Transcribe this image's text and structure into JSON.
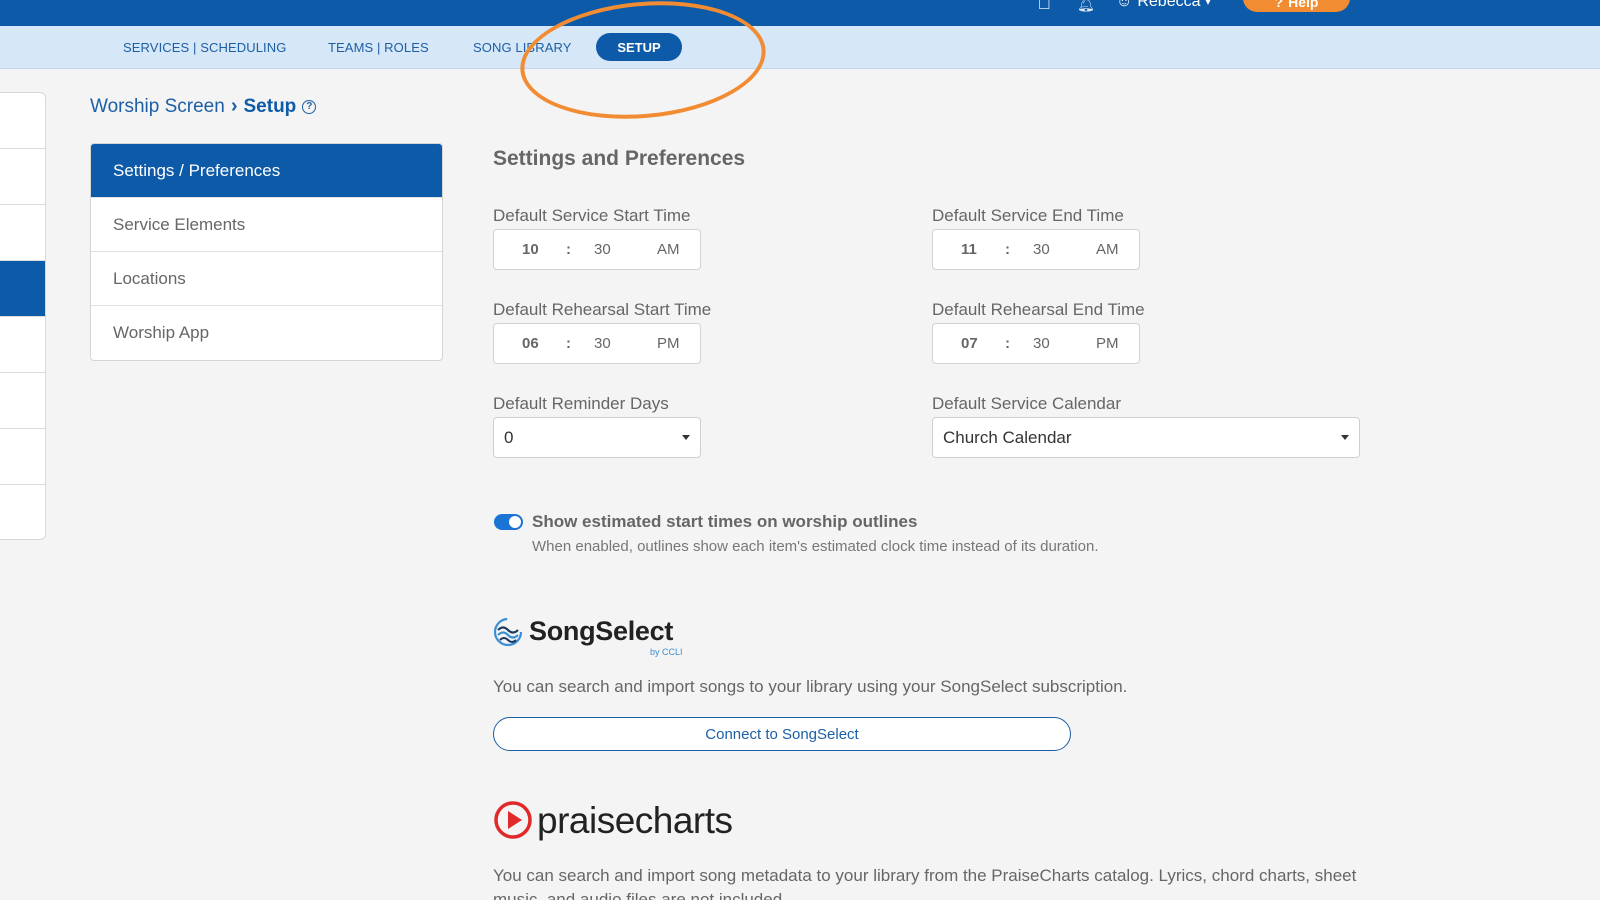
{
  "topbar": {
    "user_name": "Rebecca",
    "help_label": "Help"
  },
  "nav": {
    "items": [
      "SERVICES | SCHEDULING",
      "TEAMS | ROLES",
      "SONG LIBRARY"
    ],
    "setup_label": "SETUP"
  },
  "breadcrumb": {
    "parent": "Worship Screen",
    "current": "Setup"
  },
  "sidemenu": {
    "items": [
      "Settings / Preferences",
      "Service Elements",
      "Locations",
      "Worship App"
    ],
    "active_index": 0
  },
  "main": {
    "title": "Settings and Preferences",
    "service_start": {
      "label": "Default Service Start Time",
      "hour": "10",
      "minute": "30",
      "ampm": "AM"
    },
    "service_end": {
      "label": "Default Service End Time",
      "hour": "11",
      "minute": "30",
      "ampm": "AM"
    },
    "rehearsal_start": {
      "label": "Default Rehearsal Start Time",
      "hour": "06",
      "minute": "30",
      "ampm": "PM"
    },
    "rehearsal_end": {
      "label": "Default Rehearsal End Time",
      "hour": "07",
      "minute": "30",
      "ampm": "PM"
    },
    "reminder_days": {
      "label": "Default Reminder Days",
      "value": "0"
    },
    "service_calendar": {
      "label": "Default Service Calendar",
      "value": "Church Calendar"
    },
    "toggle": {
      "enabled": true,
      "label": "Show estimated start times on worship outlines",
      "help": "When enabled, outlines show each item's estimated clock time instead of its duration."
    },
    "songselect": {
      "brand": "SongSelect",
      "byline": "by CCLI",
      "description": "You can search and import songs to your library using your SongSelect subscription.",
      "button_label": "Connect to SongSelect"
    },
    "praisecharts": {
      "brand": "praisecharts",
      "description": "You can search and import song metadata to your library from the PraiseCharts catalog. Lyrics, chord charts, sheet music, and audio files are not included."
    }
  },
  "colors": {
    "primary": "#0d5aa8",
    "subnav_bg": "#d6e7f8",
    "accent_orange": "#f28c33",
    "toggle_on": "#1c73d6",
    "praisecharts_red": "#e02a2a"
  }
}
